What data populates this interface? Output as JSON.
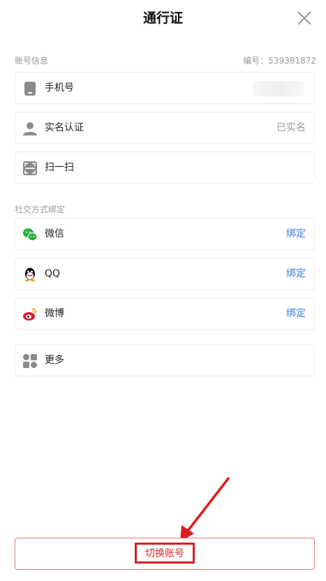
{
  "header": {
    "title": "通行证"
  },
  "account": {
    "section_label": "账号信息",
    "id_label": "编号：539381872",
    "items": [
      {
        "label": "手机号",
        "value": ""
      },
      {
        "label": "实名认证",
        "value": "已实名"
      },
      {
        "label": "扫一扫",
        "value": ""
      }
    ]
  },
  "social": {
    "section_label": "社交方式绑定",
    "items": [
      {
        "label": "微信",
        "action": "绑定",
        "icon": "wechat-icon",
        "color": "#2aae3c"
      },
      {
        "label": "QQ",
        "action": "绑定",
        "icon": "qq-icon",
        "color": "#111111"
      },
      {
        "label": "微博",
        "action": "绑定",
        "icon": "weibo-icon",
        "color": "#e6162d"
      }
    ]
  },
  "more": {
    "label": "更多"
  },
  "footer": {
    "switch_label": "切换账号"
  },
  "colors": {
    "link": "#3a7de0",
    "highlight": "#d61f1f",
    "icon_gray": "#8a8a8a"
  }
}
